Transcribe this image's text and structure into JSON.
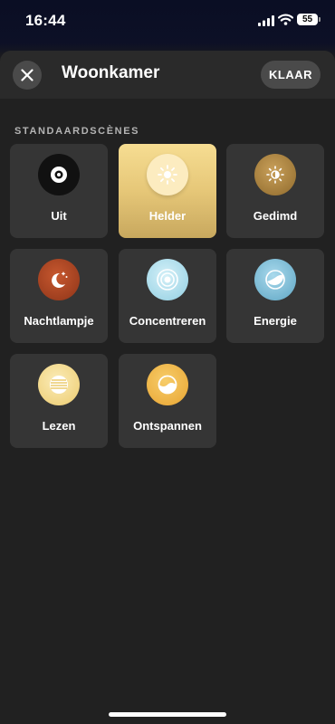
{
  "status_bar": {
    "time": "16:44",
    "battery": "55"
  },
  "header": {
    "title": "Woonkamer",
    "done_label": "KLAAR"
  },
  "section": {
    "label": "STANDAARDSCÈNES"
  },
  "scenes": [
    {
      "label": "Uit",
      "icon": "power-off-icon",
      "color": "#111111",
      "active": false
    },
    {
      "label": "Helder",
      "icon": "sun-icon",
      "color": "#fcecc0",
      "active": true
    },
    {
      "label": "Gedimd",
      "icon": "dim-sun-icon",
      "color": "#a97e37",
      "active": false
    },
    {
      "label": "Nachtlampje",
      "icon": "moon-stars-icon",
      "color": "#b54a2a",
      "active": false
    },
    {
      "label": "Concentreren",
      "icon": "concentric-circles-icon",
      "color": "#a8dcea",
      "active": false
    },
    {
      "label": "Energie",
      "icon": "energy-icon",
      "color": "#7fc1dc",
      "active": false
    },
    {
      "label": "Lezen",
      "icon": "lines-icon",
      "color": "#f5d98a",
      "active": false
    },
    {
      "label": "Ontspannen",
      "icon": "half-circle-icon",
      "color": "#f2b84a",
      "active": false
    }
  ]
}
